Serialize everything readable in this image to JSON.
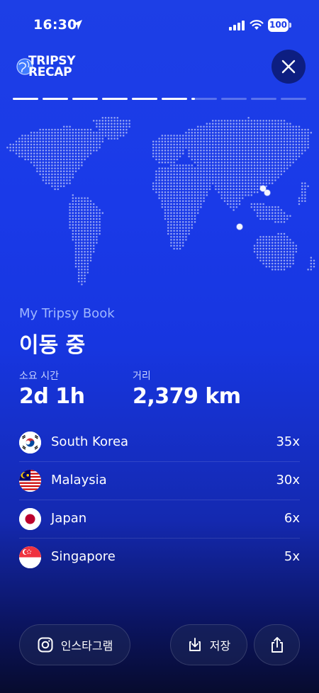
{
  "status_bar": {
    "time": "16:30",
    "battery": "100"
  },
  "header": {
    "logo_line1": "TRIPSY",
    "logo_line2": "RECAP"
  },
  "progress": {
    "segments": 10,
    "completed": 6,
    "current_fraction": 0.15
  },
  "summary": {
    "book_label": "My Tripsy Book",
    "title": "이동 중",
    "duration_label": "소요 시간",
    "duration_value": "2d 1h",
    "distance_label": "거리",
    "distance_value": "2,379 km"
  },
  "countries": [
    {
      "name": "South Korea",
      "count": "35x",
      "flag": "south-korea-flag"
    },
    {
      "name": "Malaysia",
      "count": "30x",
      "flag": "malaysia-flag"
    },
    {
      "name": "Japan",
      "count": "6x",
      "flag": "japan-flag"
    },
    {
      "name": "Singapore",
      "count": "5x",
      "flag": "singapore-flag"
    }
  ],
  "actions": {
    "instagram_label": "인스타그램",
    "save_label": "저장"
  },
  "colors": {
    "background_top": "#1d3fe6",
    "background_bottom": "#070b2e",
    "accent_label": "#9fb6ff"
  }
}
